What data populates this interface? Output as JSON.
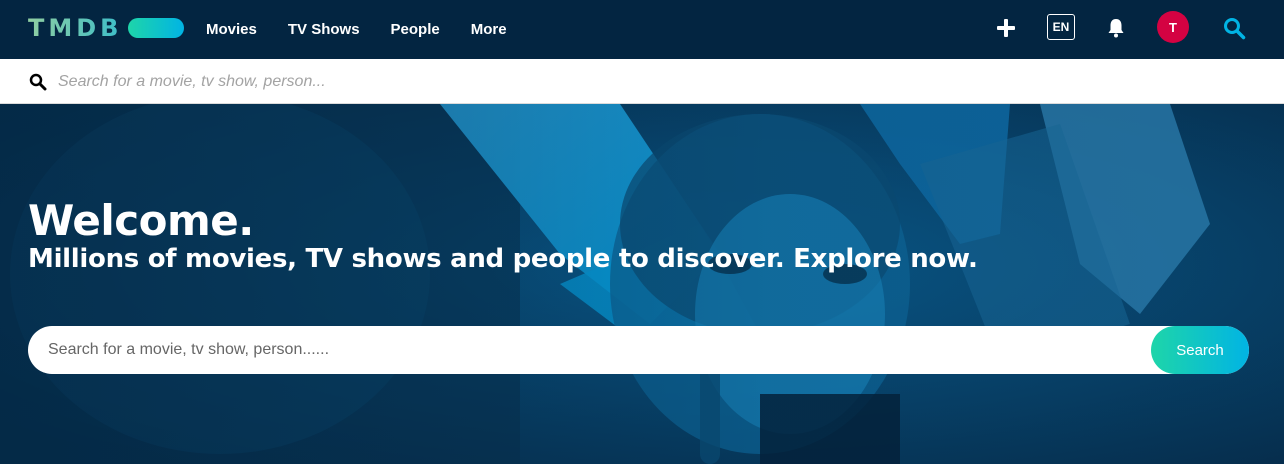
{
  "brand": {
    "logo_text": "TMDB"
  },
  "nav": {
    "links": [
      "Movies",
      "TV Shows",
      "People",
      "More"
    ],
    "lang": "EN",
    "avatar_initial": "T",
    "icons": [
      "plus-icon",
      "bell-icon",
      "search-icon"
    ]
  },
  "searchbar": {
    "placeholder": "Search for a movie, tv show, person..."
  },
  "hero": {
    "title": "Welcome.",
    "subtitle": "Millions of movies, TV shows and people to discover. Explore now.",
    "search_placeholder": "Search for a movie, tv show, person......",
    "search_button": "Search"
  },
  "colors": {
    "nav_bg": "#032541",
    "accent_green": "#1ed5a9",
    "accent_blue": "#01b4e4",
    "avatar_bg": "#d40242"
  }
}
